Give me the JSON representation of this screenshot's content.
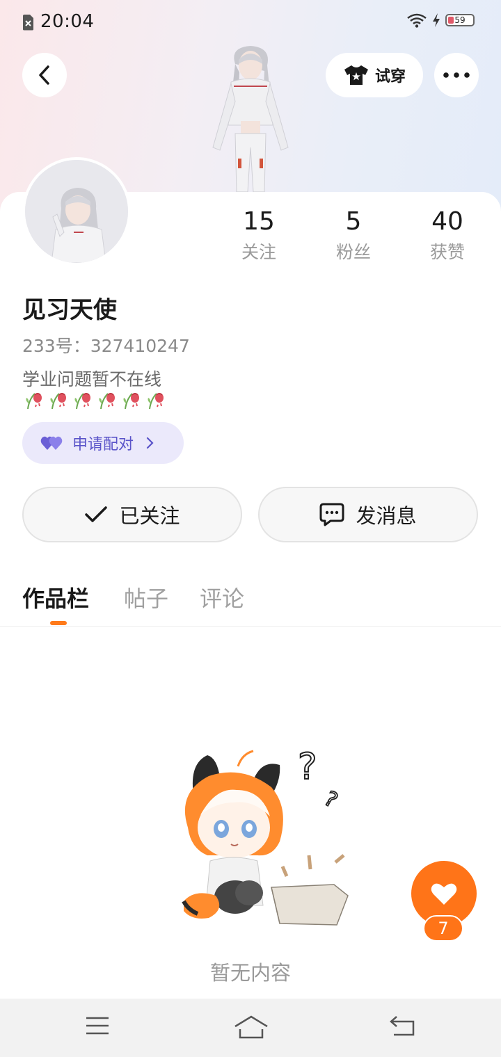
{
  "status_bar": {
    "time": "20:04",
    "battery": "59",
    "icons": [
      "sim-off-icon",
      "wifi-icon",
      "charging-bolt-icon",
      "battery-icon"
    ]
  },
  "header": {
    "try_on_label": "试穿",
    "icons": [
      "back-arrow-icon",
      "tshirt-icon",
      "more-dots-icon"
    ]
  },
  "profile": {
    "stats": [
      {
        "value": "15",
        "label": "关注"
      },
      {
        "value": "5",
        "label": "粉丝"
      },
      {
        "value": "40",
        "label": "获赞"
      }
    ],
    "username": "见习天使",
    "user_id": "233号：327410247",
    "bio": "学业问题暂不在线",
    "bio_emoji_count": 6,
    "pair_label": "申请配对"
  },
  "actions": {
    "follow_label": "已关注",
    "message_label": "发消息"
  },
  "tabs": [
    {
      "label": "作品栏",
      "active": true
    },
    {
      "label": "帖子",
      "active": false
    },
    {
      "label": "评论",
      "active": false
    }
  ],
  "empty_state": {
    "text": "暂无内容"
  },
  "like_fab": {
    "count": "7"
  },
  "nav_bar": {
    "icons": [
      "menu-icon",
      "home-icon",
      "back-icon"
    ]
  },
  "colors": {
    "accent": "#ff7418",
    "pair_bg": "#ebe9fb",
    "pair_text": "#5a54c9"
  }
}
